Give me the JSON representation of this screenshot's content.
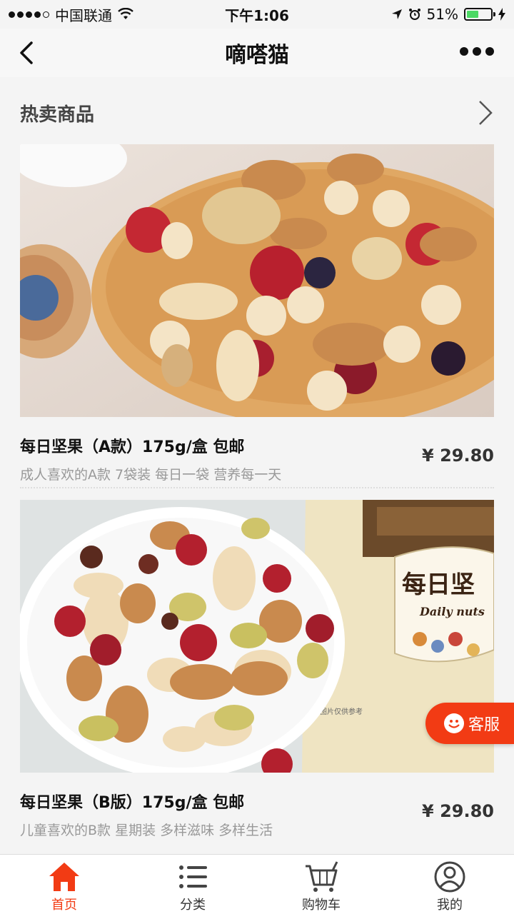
{
  "status_bar": {
    "carrier": "中国联通",
    "time": "下午1:06",
    "battery": "51%",
    "battery_level": 0.51
  },
  "navbar": {
    "title": "嘀嗒猫"
  },
  "section": {
    "title": "热卖商品"
  },
  "products": [
    {
      "name": "每日坚果（A款）175g/盒 包邮",
      "desc": "成人喜欢的A款 7袋装 每日一袋 营养每一天",
      "price": "¥ 29.80"
    },
    {
      "name": "每日坚果（B版）175g/盒 包邮",
      "desc": "儿童喜欢的B款 星期装 多样滋味 多样生活",
      "price": "¥ 29.80",
      "package_text": "每日坚",
      "package_subtext": "Daily nuts",
      "package_note": "图片仅供参考"
    }
  ],
  "cs_button": {
    "label": "客服"
  },
  "tabbar": {
    "items": [
      {
        "label": "首页",
        "icon": "home-icon",
        "active": true
      },
      {
        "label": "分类",
        "icon": "list-icon",
        "active": false
      },
      {
        "label": "购物车",
        "icon": "cart-icon",
        "active": false
      },
      {
        "label": "我的",
        "icon": "user-icon",
        "active": false
      }
    ]
  },
  "colors": {
    "accent": "#f23b14",
    "battery": "#4cd964"
  }
}
